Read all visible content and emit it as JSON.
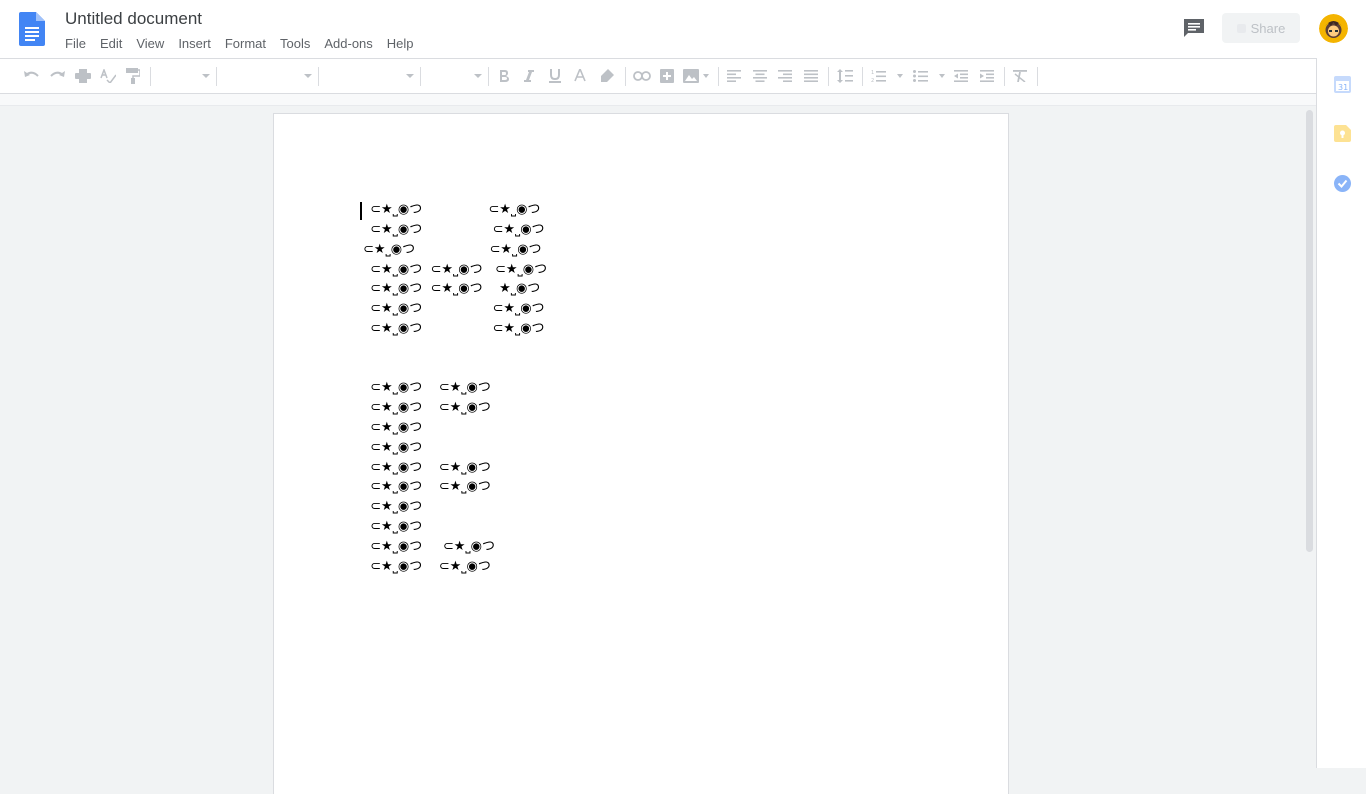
{
  "document": {
    "title": "Untitled document"
  },
  "menu": [
    "File",
    "Edit",
    "View",
    "Insert",
    "Format",
    "Tools",
    "Add-ons",
    "Help"
  ],
  "header": {
    "share_label": "Share"
  },
  "body": {
    "lines_block1": [
      " ⊂★⎵◉つ                ⊂★⎵◉つ",
      " ⊂★⎵◉つ                 ⊂★⎵◉つ",
      "⊂★⎵◉つ                  ⊂★⎵◉つ",
      " ⊂★⎵◉つ  ⊂★⎵◉つ   ⊂★⎵◉つ",
      " ⊂★⎵◉つ  ⊂★⎵◉つ    ★⎵◉つ",
      " ⊂★⎵◉つ                 ⊂★⎵◉つ",
      " ⊂★⎵◉つ                 ⊂★⎵◉つ"
    ],
    "lines_block2": [
      " ⊂★⎵◉つ    ⊂★⎵◉つ",
      " ⊂★⎵◉つ    ⊂★⎵◉つ",
      " ⊂★⎵◉つ",
      " ⊂★⎵◉つ",
      " ⊂★⎵◉つ    ⊂★⎵◉つ",
      " ⊂★⎵◉つ    ⊂★⎵◉つ",
      " ⊂★⎵◉つ",
      " ⊂★⎵◉つ",
      " ⊂★⎵◉つ     ⊂★⎵◉つ",
      " ⊂★⎵◉つ    ⊂★⎵◉つ"
    ]
  },
  "colors": {
    "docs_blue": "#4285f4",
    "toolbar_icon_disabled": "#bdc1c6",
    "page_bg": "#ffffff",
    "canvas_bg": "#f1f3f4"
  },
  "icons": {
    "toolbar": [
      "undo-icon",
      "redo-icon",
      "print-icon",
      "spellcheck-icon",
      "paint-format-icon",
      "bold-icon",
      "italic-icon",
      "underline-icon",
      "text-color-icon",
      "highlight-icon",
      "link-icon",
      "comment-add-icon",
      "image-icon",
      "align-left-icon",
      "align-center-icon",
      "align-right-icon",
      "align-justify-icon",
      "line-spacing-icon",
      "numbered-list-icon",
      "bulleted-list-icon",
      "decrease-indent-icon",
      "increase-indent-icon",
      "clear-formatting-icon"
    ],
    "side": [
      "calendar-icon",
      "keep-icon",
      "tasks-icon"
    ]
  }
}
